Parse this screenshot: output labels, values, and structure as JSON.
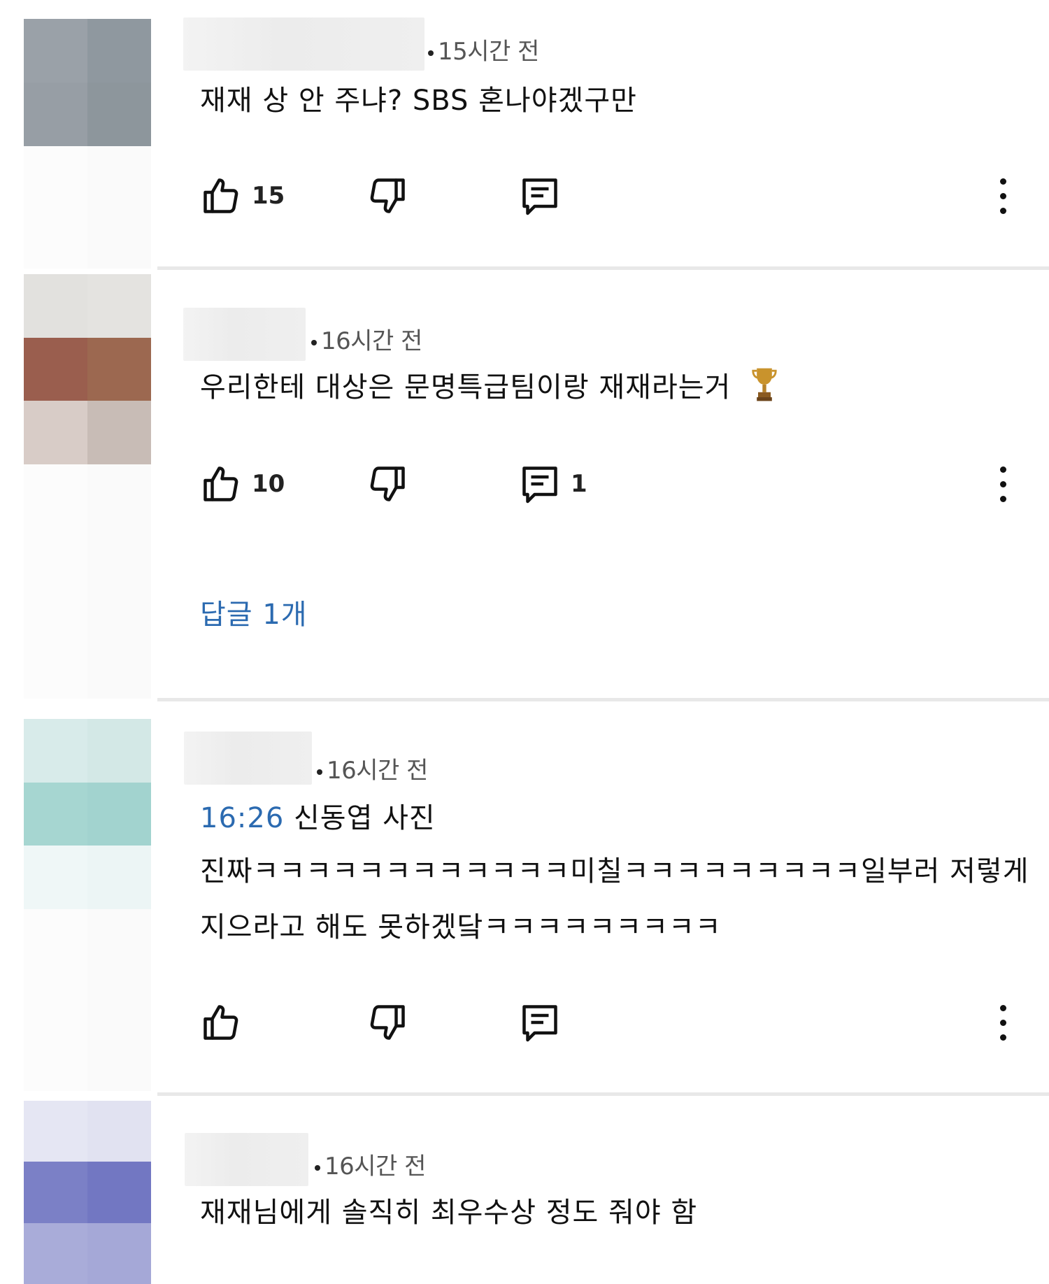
{
  "comments": [
    {
      "timestamp": "15시간 전",
      "text_lines": [
        "재재 상 안 주냐? SBS 혼나야겠구만"
      ],
      "likes": "15",
      "replies_count": "",
      "avatar_colors": [
        "#9aa1a8",
        "#8f989f",
        "#979ea5",
        "#8d969c"
      ]
    },
    {
      "timestamp": "16시간 전",
      "text_lines": [
        "우리한테 대상은 문명특급팀이랑 재재라는거"
      ],
      "trailing_icon": "trophy-icon",
      "likes": "10",
      "replies_count": "1",
      "replies_link": "답글 1개",
      "avatar_colors": [
        "#e2e1de",
        "#e4e3e0",
        "#9a5e4e",
        "#9c6850",
        "#d8ccc7",
        "#c8bcb6"
      ]
    },
    {
      "timestamp": "16시간 전",
      "timestamp_link": "16:26",
      "text_lines": [
        "신동엽 사진",
        "진짜ㅋㅋㅋㅋㅋㅋㅋㅋㅋㅋㅋㅋ미칠ㅋㅋㅋㅋㅋㅋㅋㅋㅋ일부러 저렇게",
        "지으라고 해도 못하겠닼ㅋㅋㅋㅋㅋㅋㅋㅋㅋ"
      ],
      "likes": "",
      "replies_count": "",
      "avatar_colors": [
        "#d8ebea",
        "#d3e8e6",
        "#a6d6d1",
        "#a2d3cf",
        "#eff7f7",
        "#ecf5f5"
      ]
    },
    {
      "timestamp": "16시간 전",
      "text_lines": [
        "재재님에게 솔직히 최우수상 정도 줘야 함"
      ],
      "avatar_colors": [
        "#e5e6f3",
        "#e1e2f1",
        "#7b80c6",
        "#7277c2",
        "#a9acd9",
        "#a5a8d7"
      ]
    }
  ],
  "icons": [
    "thumbs-up-icon",
    "thumbs-down-icon",
    "reply-icon",
    "more-vertical-icon"
  ]
}
